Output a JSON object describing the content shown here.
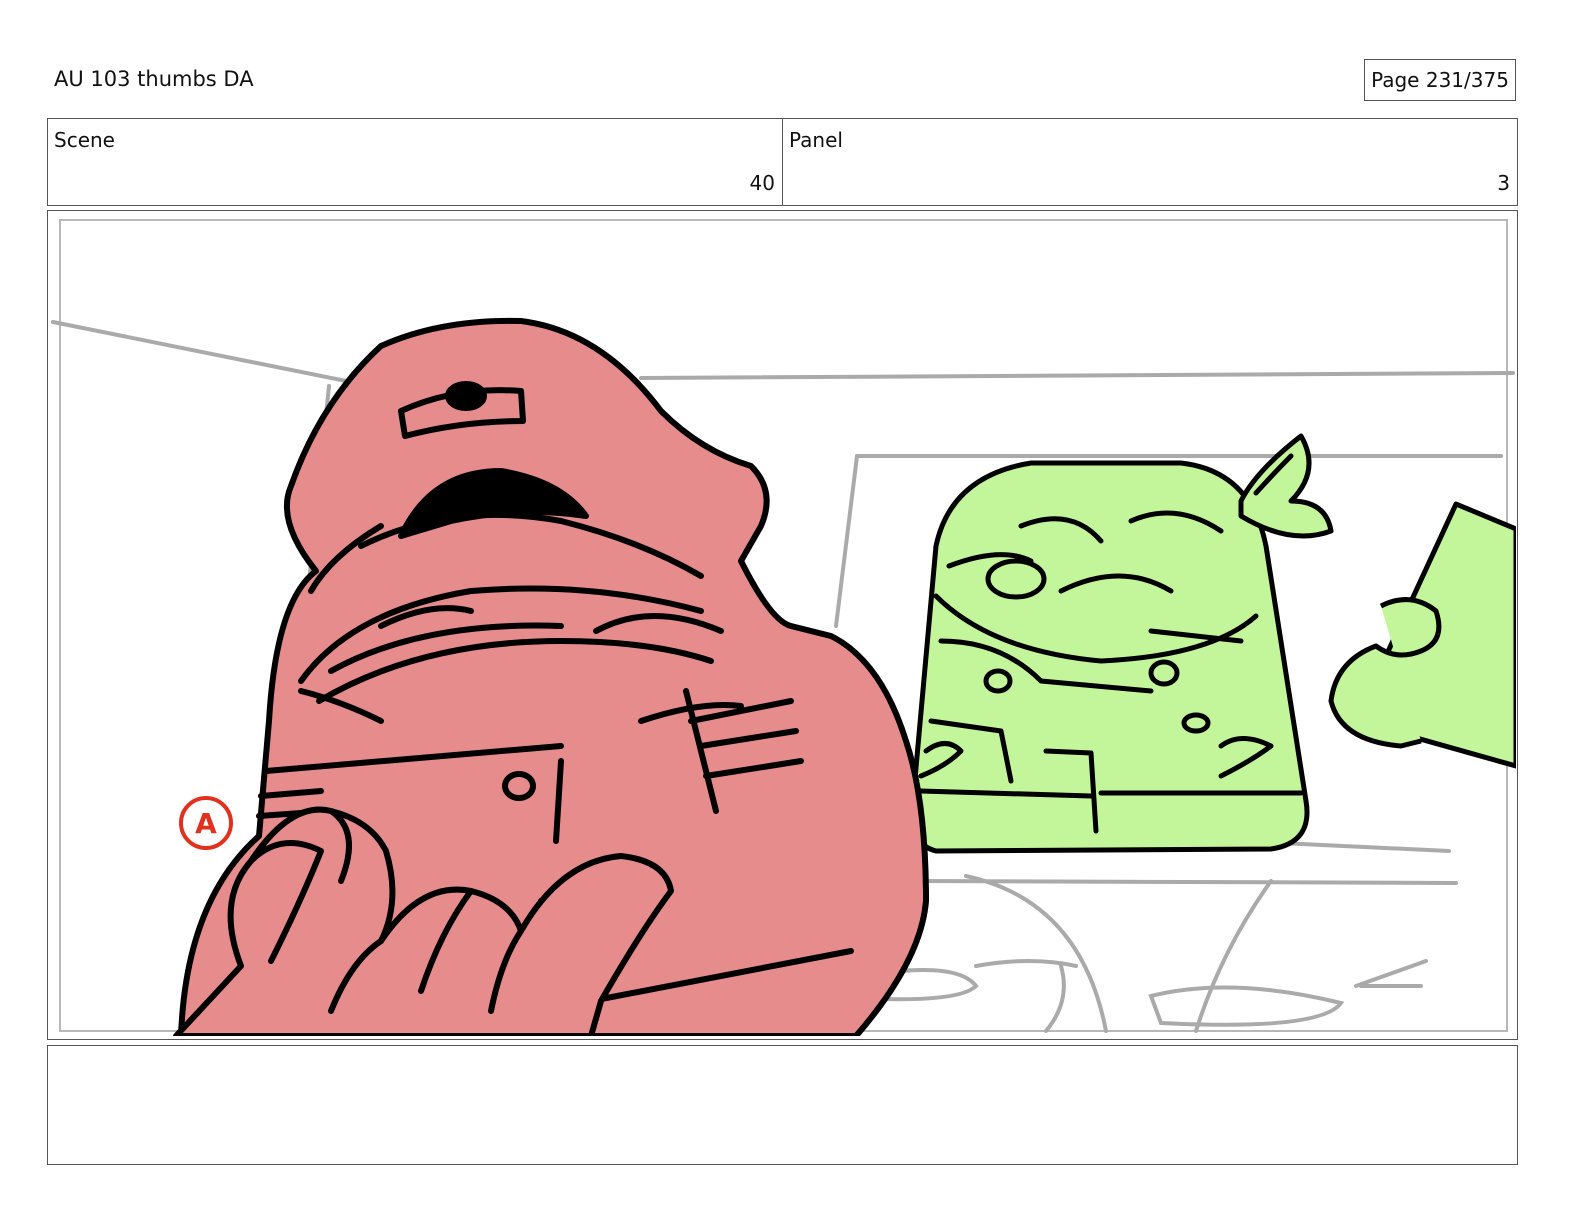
{
  "header": {
    "title": "AU 103 thumbs DA",
    "page_indicator": "Page 231/375"
  },
  "info": {
    "scene_label": "Scene",
    "scene_value": "40",
    "panel_label": "Panel",
    "panel_value": "3"
  },
  "panel": {
    "annotation_mark": "A",
    "colors": {
      "red_character": "#E68C8C",
      "green_character": "#C3F59A",
      "sketch_lines": "#AAAAAA",
      "ink": "#000000",
      "annotation": "#E0301E"
    }
  },
  "notes": {
    "text": ""
  }
}
